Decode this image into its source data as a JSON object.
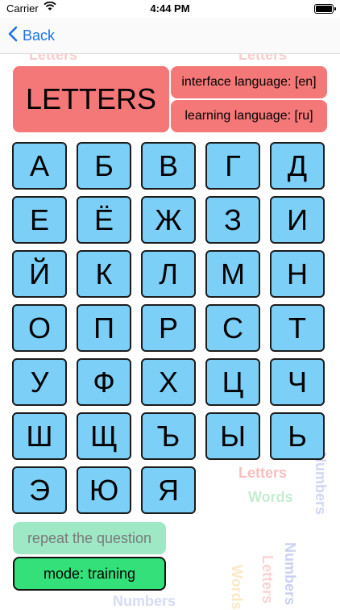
{
  "status_bar": {
    "carrier": "Carrier",
    "time": "4:44 PM"
  },
  "nav": {
    "back_label": "Back"
  },
  "header": {
    "title": "LETTERS",
    "interface_language": "interface language: [en]",
    "learning_language": "learning language: [ru]"
  },
  "letters": [
    "А",
    "Б",
    "В",
    "Г",
    "Д",
    "Е",
    "Ё",
    "Ж",
    "З",
    "И",
    "Й",
    "К",
    "Л",
    "М",
    "Н",
    "О",
    "П",
    "Р",
    "С",
    "Т",
    "У",
    "Ф",
    "Х",
    "Ц",
    "Ч",
    "Ш",
    "Щ",
    "Ъ",
    "Ы",
    "Ь",
    "Э",
    "Ю",
    "Я"
  ],
  "actions": {
    "repeat_label": "repeat the question",
    "mode_label": "mode: training"
  },
  "background_words": {
    "letters": "Letters",
    "words": "Words",
    "numbers": "Numbers"
  },
  "colors": {
    "header_red": "#f47878",
    "key_blue": "#7ccff7",
    "repeat_green": "#9ee8c5",
    "mode_green": "#33e07a",
    "link_blue": "#1a73e8"
  }
}
